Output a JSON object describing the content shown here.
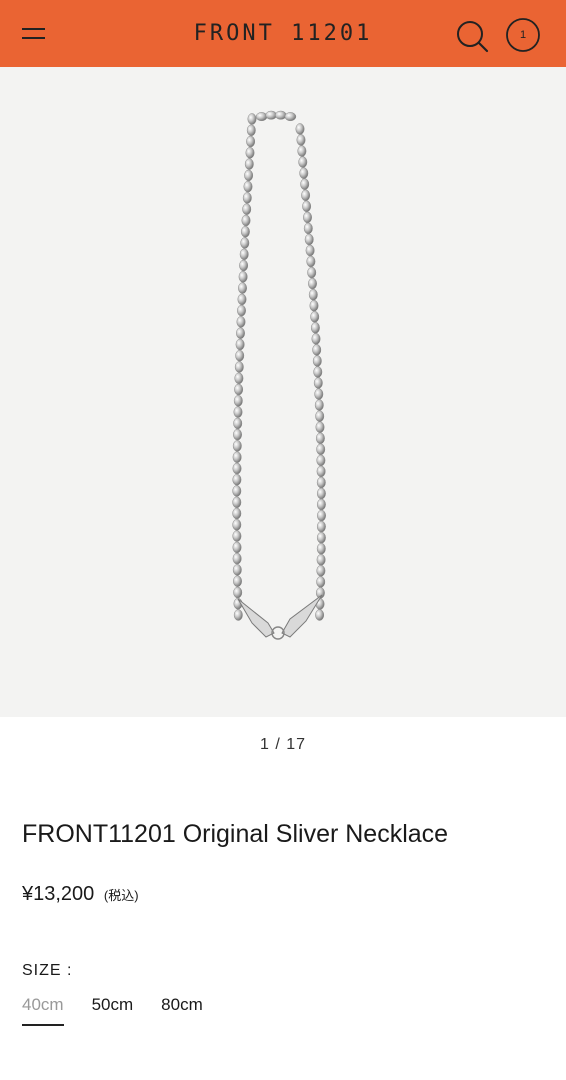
{
  "header": {
    "logo": "FRONT 11201",
    "cart_count": "1",
    "icons": [
      "hamburger-menu-icon",
      "search-icon",
      "cart-count-icon"
    ],
    "background_color": "#ea6433"
  },
  "gallery": {
    "current": 1,
    "total": 17,
    "pager_text": "1 / 17"
  },
  "product": {
    "title": "FRONT11201 Original Sliver Necklace",
    "price": "¥13,200",
    "tax_note": "(税込)"
  },
  "size": {
    "label": "SIZE :",
    "options": [
      "40cm",
      "50cm",
      "80cm"
    ],
    "selected": "40cm"
  }
}
